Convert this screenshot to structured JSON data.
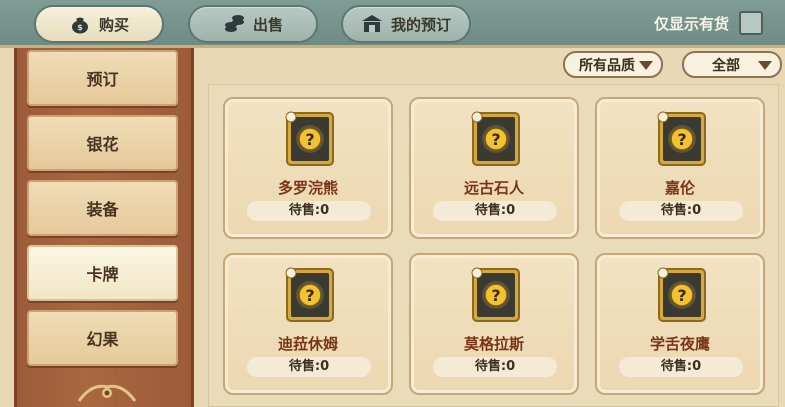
{
  "tabs": [
    {
      "label": "购买",
      "icon": "money-bag-icon",
      "active": true
    },
    {
      "label": "出售",
      "icon": "coins-icon",
      "active": false
    },
    {
      "label": "我的预订",
      "icon": "shop-icon",
      "active": false
    }
  ],
  "stock_filter": {
    "label": "仅显示有货",
    "checked": false
  },
  "sidebar": {
    "items": [
      {
        "label": "预订",
        "active": false
      },
      {
        "label": "银花",
        "active": false
      },
      {
        "label": "装备",
        "active": false
      },
      {
        "label": "卡牌",
        "active": true
      },
      {
        "label": "幻果",
        "active": false
      }
    ]
  },
  "filters": {
    "quality": {
      "label": "所有品质"
    },
    "scope": {
      "label": "全部"
    }
  },
  "cards": [
    {
      "name": "多罗浣熊",
      "status": "待售:0",
      "frame": "gold"
    },
    {
      "name": "远古石人",
      "status": "待售:0",
      "frame": "gold"
    },
    {
      "name": "嘉伦",
      "status": "待售:0",
      "frame": "gold"
    },
    {
      "name": "迪菈休姆",
      "status": "待售:0",
      "frame": "gold"
    },
    {
      "name": "莫格拉斯",
      "status": "待售:0",
      "frame": "gold"
    },
    {
      "name": "学舌夜鹰",
      "status": "待售:0",
      "frame": "gold"
    }
  ],
  "colors": {
    "topbar": "#7f9c95",
    "sidebar": "#a9683f",
    "card_name": "#7a3518",
    "card_frame": "#d6a93a",
    "question_mark": "#f2c230"
  }
}
